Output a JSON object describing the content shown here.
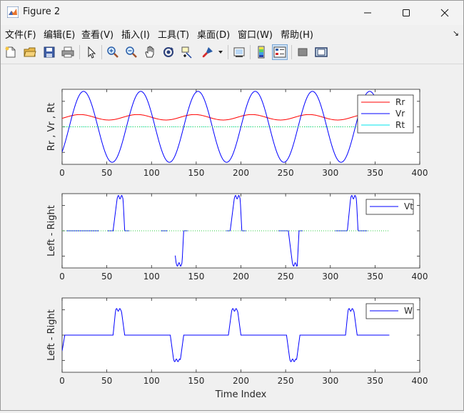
{
  "window": {
    "title": "Figure 2"
  },
  "menu": [
    {
      "label": "文件(F)"
    },
    {
      "label": "编辑(E)"
    },
    {
      "label": "查看(V)"
    },
    {
      "label": "插入(I)"
    },
    {
      "label": "工具(T)"
    },
    {
      "label": "桌面(D)"
    },
    {
      "label": "窗口(W)"
    },
    {
      "label": "帮助(H)"
    }
  ],
  "menu_overflow": "↘",
  "toolbar": {
    "icons": [
      "new-figure-icon",
      "open-file-icon",
      "save-icon",
      "print-icon",
      "pointer-icon",
      "zoom-in-icon",
      "zoom-out-icon",
      "pan-hand-icon",
      "rotate-3d-icon",
      "data-cursor-icon",
      "brush-icon",
      "brush-dropdown-icon",
      "link-plot-icon",
      "insert-colorbar-icon",
      "insert-legend-icon",
      "hide-plot-tools-icon",
      "show-plot-tools-icon"
    ]
  },
  "chart_data": [
    {
      "type": "line",
      "title": "",
      "xlabel": "",
      "ylabel": "Rr , Vr , Rt",
      "xlim": [
        0,
        400
      ],
      "ylim": [
        -1.1,
        1.1
      ],
      "xticks": [
        "0",
        "50",
        "100",
        "150",
        "200",
        "250",
        "300",
        "350",
        "400"
      ],
      "legend": {
        "placement": "top-right",
        "entries": [
          "Rr",
          "Vr",
          "Rt"
        ]
      },
      "series": [
        {
          "name": "Rr",
          "color": "#ff0000",
          "kind": "sin",
          "period": 64,
          "phase": -0.4,
          "amp": 0.08,
          "offset": 0.28,
          "xmax": 335
        },
        {
          "name": "Vr",
          "color": "#0000ff",
          "kind": "sin",
          "period": 64,
          "phase": -0.7854,
          "amp": 1.0,
          "offset": 0.0,
          "xmax": 352
        },
        {
          "name": "Rt",
          "color": "#00e5ee",
          "kind": "const",
          "value": 0.0,
          "xmax": 345
        },
        {
          "name": "",
          "color": "#2ecc40",
          "kind": "dotted",
          "value": 0.0,
          "xmax": 345
        }
      ]
    },
    {
      "type": "line",
      "title": "",
      "xlabel": "",
      "ylabel": "Left - Right",
      "xlim": [
        0,
        400
      ],
      "ylim": [
        -1.05,
        1.05
      ],
      "xticks": [
        "0",
        "50",
        "100",
        "150",
        "200",
        "250",
        "300",
        "350",
        "400"
      ],
      "legend": {
        "placement": "top-right",
        "entries": [
          "Vt"
        ]
      },
      "series": [
        {
          "name": "Vt",
          "color": "#0000ff",
          "kind": "pulses",
          "xmax": 366,
          "pulses": [
            [
              57,
              62,
              68,
              70,
              1
            ],
            [
              123,
              128,
              134,
              136,
              -1
            ],
            [
              188,
              193,
              199,
              201,
              1
            ],
            [
              253,
              258,
              263,
              265,
              -1
            ],
            [
              319,
              323,
              329,
              331,
              1
            ]
          ],
          "gaps": [
            [
              0,
              4
            ],
            [
              42,
              50
            ],
            [
              76,
              110
            ],
            [
              118,
              126
            ],
            [
              141,
              183
            ],
            [
              206,
              241
            ],
            [
              270,
              305
            ],
            [
              342,
              366
            ]
          ]
        },
        {
          "name": "",
          "color": "#2ecc40",
          "kind": "dotted",
          "value": 0.0,
          "xmax": 366
        }
      ]
    },
    {
      "type": "line",
      "title": "",
      "xlabel": "Time Index",
      "ylabel": "Left - Right",
      "xlim": [
        0,
        400
      ],
      "ylim": [
        -1.05,
        1.05
      ],
      "xticks": [
        "0",
        "50",
        "100",
        "150",
        "200",
        "250",
        "300",
        "350",
        "400"
      ],
      "legend": {
        "placement": "top-right",
        "entries": [
          "W"
        ]
      },
      "series": [
        {
          "name": "W",
          "color": "#0000ff",
          "kind": "pulses",
          "xmax": 366,
          "pulses": [
            [
              57,
              60,
              66,
              70,
              0.75
            ],
            [
              121,
              125,
              132,
              136,
              -0.75
            ],
            [
              186,
              190,
              196,
              200,
              0.75
            ],
            [
              251,
              255,
              262,
              266,
              -0.75
            ],
            [
              317,
              320,
              326,
              330,
              0.75
            ]
          ],
          "gaps": []
        }
      ]
    }
  ]
}
